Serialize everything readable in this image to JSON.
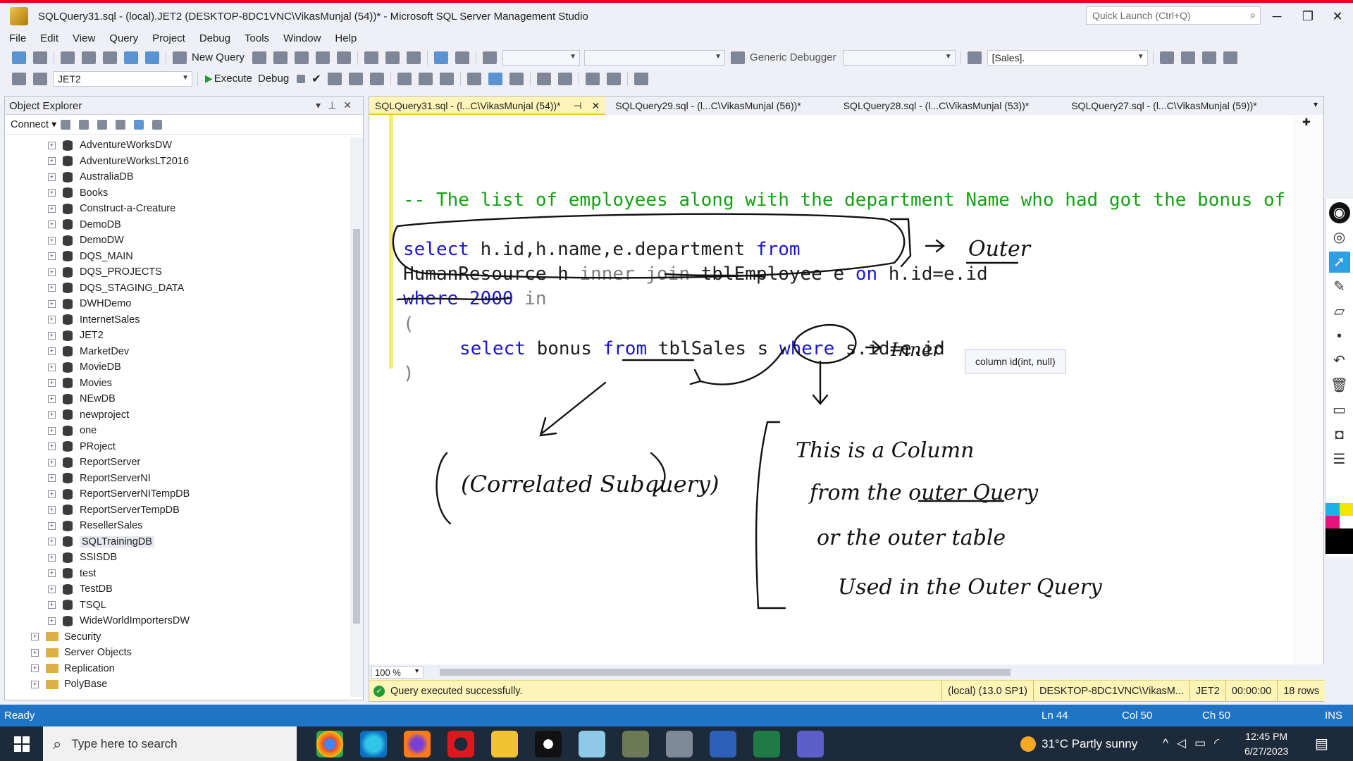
{
  "window": {
    "title": "SQLQuery31.sql - (local).JET2 (DESKTOP-8DC1VNC\\VikasMunjal (54))* - Microsoft SQL Server Management Studio",
    "quick_launch_placeholder": "Quick Launch (Ctrl+Q)",
    "minimize": "─",
    "restore": "❐",
    "close": "✕"
  },
  "menu": [
    "File",
    "Edit",
    "View",
    "Query",
    "Project",
    "Debug",
    "Tools",
    "Window",
    "Help"
  ],
  "toolbar1": {
    "new_query": "New Query",
    "debugger": "Generic Debugger",
    "sales_combo": "[Sales]."
  },
  "toolbar2": {
    "database": "JET2",
    "execute": "Execute",
    "debug": "Debug"
  },
  "object_explorer": {
    "title": "Object Explorer",
    "connect": "Connect",
    "databases": [
      "AdventureWorksDW",
      "AdventureWorksLT2016",
      "AustraliaDB",
      "Books",
      "Construct-a-Creature",
      "DemoDB",
      "DemoDW",
      "DQS_MAIN",
      "DQS_PROJECTS",
      "DQS_STAGING_DATA",
      "DWHDemo",
      "InternetSales",
      "JET2",
      "MarketDev",
      "MovieDB",
      "Movies",
      "NEwDB",
      "newproject",
      "one",
      "PRoject",
      "ReportServer",
      "ReportServerNI",
      "ReportServerNITempDB",
      "ReportServerTempDB",
      "ResellerSales",
      "SQLTrainingDB",
      "SSISDB",
      "test",
      "TestDB",
      "TSQL",
      "WideWorldImportersDW"
    ],
    "folders": [
      "Security",
      "Server Objects",
      "Replication",
      "PolyBase"
    ]
  },
  "tabs": [
    "SQLQuery31.sql - (l...C\\VikasMunjal (54))*",
    "SQLQuery29.sql - (l...C\\VikasMunjal (56))*",
    "SQLQuery28.sql - (l...C\\VikasMunjal (53))*",
    "SQLQuery27.sql - (l...C\\VikasMunjal (59))*"
  ],
  "code": {
    "comment": "-- The list of employees along with the department Name who had got the bonus of",
    "l1_kw1": "select",
    "l1_mid": " h.id,h.name,e.department ",
    "l1_kw2": "from",
    "l2_a": "HumanResource h ",
    "l2_gray": "inner join",
    "l2_b": " tblEmployee e ",
    "l2_kw": "on",
    "l2_c": " h.id=e.id",
    "l3_kw": "where 2000",
    "l3_gray": " in",
    "l4": "(",
    "l5_kw1": "select",
    "l5_a": " bonus ",
    "l5_kw2": "from",
    "l5_b": " tblSales s ",
    "l5_kw3": "where",
    "l5_c": " s.id=e.id",
    "l6": ")"
  },
  "tooltip": "column id(int, null)",
  "ink_annotations": {
    "outer": "Outer",
    "inner": "Inner",
    "correlated": "(Correlated Subquery)",
    "note_lines": [
      "This is a Column",
      "from the outer Query",
      "or the outer table",
      "Used in the Outer Query"
    ]
  },
  "editor_status": {
    "zoom": "100 %",
    "message": "Query executed successfully.",
    "server": "(local) (13.0 SP1)",
    "user": "DESKTOP-8DC1VNC\\VikasM...",
    "db": "JET2",
    "time": "00:00:00",
    "rows": "18 rows"
  },
  "statusbar": {
    "ready": "Ready",
    "ln": "Ln 44",
    "col": "Col 50",
    "ch": "Ch 50",
    "ins": "INS"
  },
  "taskbar": {
    "search_placeholder": "Type here to search",
    "weather": "31°C  Partly sunny",
    "time": "12:45 PM",
    "date": "6/27/2023"
  },
  "colors": {
    "keyword": "#1a16d6",
    "comment": "#14a114",
    "statusbar": "#1f74c6",
    "pen_ink": "#111111"
  }
}
